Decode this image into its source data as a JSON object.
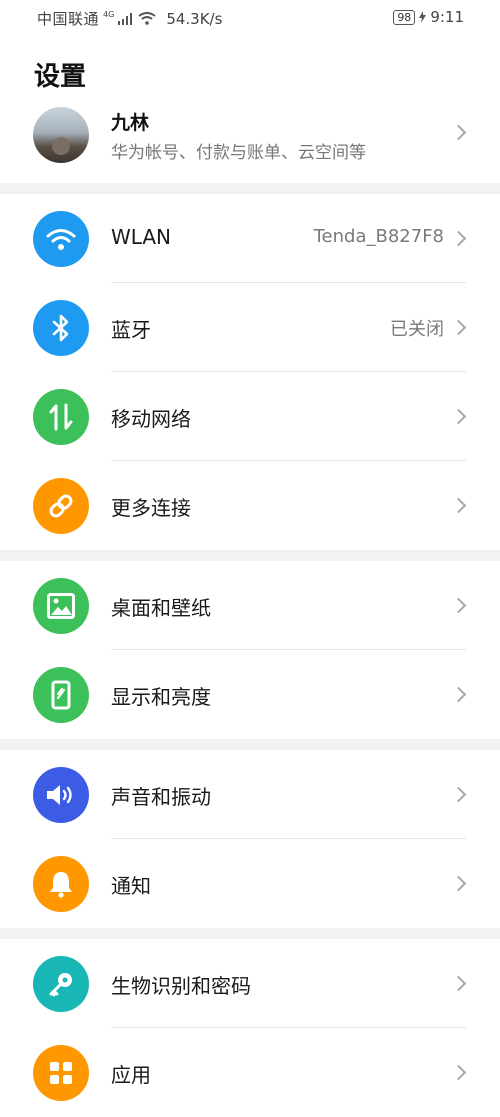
{
  "status": {
    "carrier": "中国联通",
    "network": "4G",
    "speed": "54.3K/s",
    "battery": "98",
    "time": "9:11"
  },
  "title": "设置",
  "profile": {
    "name": "九林",
    "subtitle": "华为帐号、付款与账单、云空间等"
  },
  "items": [
    {
      "label": "WLAN",
      "value": "Tenda_B827F8",
      "icon": "wifi-icon",
      "color": "#1e9bf0"
    },
    {
      "label": "蓝牙",
      "value": "已关闭",
      "icon": "bluetooth-icon",
      "color": "#1e9bf0"
    },
    {
      "label": "移动网络",
      "value": "",
      "icon": "mobile-data-icon",
      "color": "#3cc15a"
    },
    {
      "label": "更多连接",
      "value": "",
      "icon": "link-icon",
      "color": "#ff9800"
    },
    {
      "label": "桌面和壁纸",
      "value": "",
      "icon": "wallpaper-icon",
      "color": "#3cc15a"
    },
    {
      "label": "显示和亮度",
      "value": "",
      "icon": "display-icon",
      "color": "#3cc15a"
    },
    {
      "label": "声音和振动",
      "value": "",
      "icon": "sound-icon",
      "color": "#3d5ce6"
    },
    {
      "label": "通知",
      "value": "",
      "icon": "notification-bell-icon",
      "color": "#ff9800"
    },
    {
      "label": "生物识别和密码",
      "value": "",
      "icon": "key-icon",
      "color": "#19b6b6"
    },
    {
      "label": "应用",
      "value": "",
      "icon": "apps-icon",
      "color": "#ff9800"
    }
  ]
}
